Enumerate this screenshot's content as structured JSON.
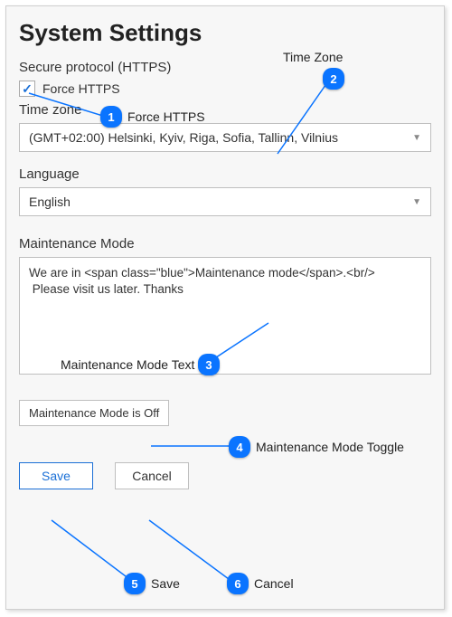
{
  "title": "System Settings",
  "secure_protocol": {
    "section_label": "Secure protocol (HTTPS)",
    "checkbox_label": "Force HTTPS",
    "checked": true
  },
  "timezone": {
    "section_label": "Time zone",
    "value": "(GMT+02:00) Helsinki, Kyiv, Riga, Sofia, Tallinn, Vilnius"
  },
  "language": {
    "section_label": "Language",
    "value": "English"
  },
  "maintenance": {
    "section_label": "Maintenance Mode",
    "text": "We are in <span class=\"blue\">Maintenance mode</span>.<br/>\n Please visit us later. Thanks",
    "toggle_label": "Maintenance Mode is Off"
  },
  "buttons": {
    "save": "Save",
    "cancel": "Cancel"
  },
  "annotations": {
    "a1": {
      "num": "1",
      "label": "Force HTTPS"
    },
    "a2": {
      "num": "2",
      "label": "Time Zone"
    },
    "a3": {
      "num": "3",
      "label": "Maintenance Mode Text"
    },
    "a4": {
      "num": "4",
      "label": "Maintenance Mode Toggle"
    },
    "a5": {
      "num": "5",
      "label": "Save"
    },
    "a6": {
      "num": "6",
      "label": "Cancel"
    }
  }
}
